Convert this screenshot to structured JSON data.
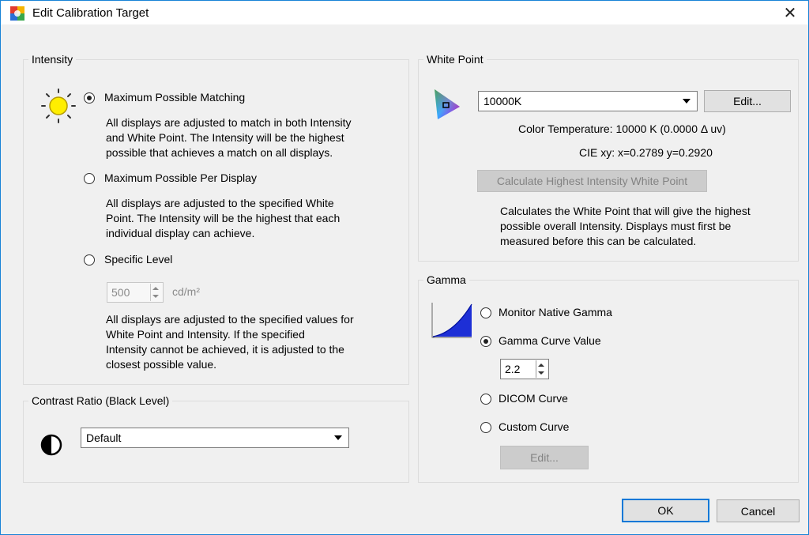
{
  "window": {
    "title": "Edit Calibration Target",
    "close_glyph": "✕"
  },
  "intensity": {
    "legend": "Intensity",
    "options": [
      {
        "label": "Maximum Possible Matching",
        "checked": true,
        "description": [
          "All displays are adjusted to match in both Intensity",
          "and White Point. The Intensity will be the highest",
          "possible that achieves a match on all displays."
        ]
      },
      {
        "label": "Maximum Possible Per Display",
        "checked": false,
        "description": [
          "All displays are adjusted to the specified White",
          "Point. The Intensity will be the highest that each",
          "individual display can achieve."
        ]
      },
      {
        "label": "Specific Level",
        "checked": false,
        "description": [
          "All displays are adjusted to the specified values for",
          "White Point and Intensity. If the specified",
          "Intensity cannot be achieved, it is adjusted to the",
          "closest possible value."
        ]
      }
    ],
    "level_value": "500",
    "level_unit": "cd/m²"
  },
  "contrast": {
    "legend": "Contrast Ratio (Black Level)",
    "selected": "Default"
  },
  "white_point": {
    "legend": "White Point",
    "selected": "10000K",
    "edit_label": "Edit...",
    "color_temp": "Color Temperature:  10000 K (0.0000 Δ uv)",
    "cie": "CIE xy:  x=0.2789 y=0.2920",
    "calc_label": "Calculate Highest Intensity White Point",
    "calc_description": [
      "Calculates the White Point that will give the highest",
      "possible overall Intensity. Displays must first be",
      "measured before this can be calculated."
    ]
  },
  "gamma": {
    "legend": "Gamma",
    "options": [
      {
        "label": "Monitor Native Gamma",
        "checked": false
      },
      {
        "label": "Gamma Curve Value",
        "checked": true
      },
      {
        "label": "DICOM Curve",
        "checked": false
      },
      {
        "label": "Custom Curve",
        "checked": false
      }
    ],
    "curve_value": "2.2",
    "edit_label": "Edit..."
  },
  "footer": {
    "ok_label": "OK",
    "cancel_label": "Cancel"
  },
  "icons": {
    "title": "calibration-app-icon",
    "intensity": "sun-icon",
    "contrast": "contrast-half-circle-icon",
    "white_point": "color-gamut-triangle-icon",
    "gamma": "gamma-curve-icon"
  }
}
